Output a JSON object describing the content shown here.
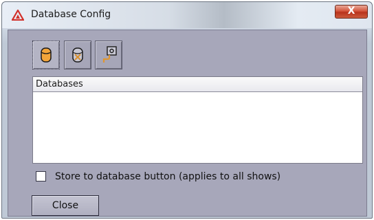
{
  "window": {
    "title": "Database Config",
    "close_glyph": "X"
  },
  "toolbar": {
    "buttons": [
      {
        "icon": "database-icon",
        "state": "active"
      },
      {
        "icon": "delete-database-icon",
        "state": "normal"
      },
      {
        "icon": "connect-database-icon",
        "state": "normal"
      }
    ]
  },
  "databases": {
    "header": "Databases",
    "items": []
  },
  "options": {
    "store_label": "Store to database button (applies to all shows)",
    "store_checked": false
  },
  "footer": {
    "close_label": "Close"
  },
  "colors": {
    "client_bg": "#a7a7ba",
    "accent_orange": "#f0a23c",
    "close_red": "#c8452c"
  }
}
